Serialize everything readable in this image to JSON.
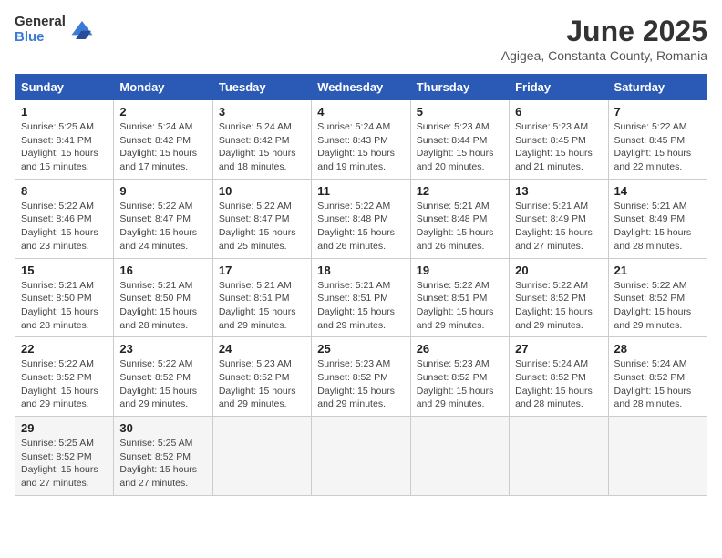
{
  "header": {
    "logo_general": "General",
    "logo_blue": "Blue",
    "month_title": "June 2025",
    "subtitle": "Agigea, Constanta County, Romania"
  },
  "weekdays": [
    "Sunday",
    "Monday",
    "Tuesday",
    "Wednesday",
    "Thursday",
    "Friday",
    "Saturday"
  ],
  "weeks": [
    [
      {
        "day": "1",
        "sunrise": "5:25 AM",
        "sunset": "8:41 PM",
        "daylight": "15 hours and 15 minutes."
      },
      {
        "day": "2",
        "sunrise": "5:24 AM",
        "sunset": "8:42 PM",
        "daylight": "15 hours and 17 minutes."
      },
      {
        "day": "3",
        "sunrise": "5:24 AM",
        "sunset": "8:42 PM",
        "daylight": "15 hours and 18 minutes."
      },
      {
        "day": "4",
        "sunrise": "5:24 AM",
        "sunset": "8:43 PM",
        "daylight": "15 hours and 19 minutes."
      },
      {
        "day": "5",
        "sunrise": "5:23 AM",
        "sunset": "8:44 PM",
        "daylight": "15 hours and 20 minutes."
      },
      {
        "day": "6",
        "sunrise": "5:23 AM",
        "sunset": "8:45 PM",
        "daylight": "15 hours and 21 minutes."
      },
      {
        "day": "7",
        "sunrise": "5:22 AM",
        "sunset": "8:45 PM",
        "daylight": "15 hours and 22 minutes."
      }
    ],
    [
      {
        "day": "8",
        "sunrise": "5:22 AM",
        "sunset": "8:46 PM",
        "daylight": "15 hours and 23 minutes."
      },
      {
        "day": "9",
        "sunrise": "5:22 AM",
        "sunset": "8:47 PM",
        "daylight": "15 hours and 24 minutes."
      },
      {
        "day": "10",
        "sunrise": "5:22 AM",
        "sunset": "8:47 PM",
        "daylight": "15 hours and 25 minutes."
      },
      {
        "day": "11",
        "sunrise": "5:22 AM",
        "sunset": "8:48 PM",
        "daylight": "15 hours and 26 minutes."
      },
      {
        "day": "12",
        "sunrise": "5:21 AM",
        "sunset": "8:48 PM",
        "daylight": "15 hours and 26 minutes."
      },
      {
        "day": "13",
        "sunrise": "5:21 AM",
        "sunset": "8:49 PM",
        "daylight": "15 hours and 27 minutes."
      },
      {
        "day": "14",
        "sunrise": "5:21 AM",
        "sunset": "8:49 PM",
        "daylight": "15 hours and 28 minutes."
      }
    ],
    [
      {
        "day": "15",
        "sunrise": "5:21 AM",
        "sunset": "8:50 PM",
        "daylight": "15 hours and 28 minutes."
      },
      {
        "day": "16",
        "sunrise": "5:21 AM",
        "sunset": "8:50 PM",
        "daylight": "15 hours and 28 minutes."
      },
      {
        "day": "17",
        "sunrise": "5:21 AM",
        "sunset": "8:51 PM",
        "daylight": "15 hours and 29 minutes."
      },
      {
        "day": "18",
        "sunrise": "5:21 AM",
        "sunset": "8:51 PM",
        "daylight": "15 hours and 29 minutes."
      },
      {
        "day": "19",
        "sunrise": "5:22 AM",
        "sunset": "8:51 PM",
        "daylight": "15 hours and 29 minutes."
      },
      {
        "day": "20",
        "sunrise": "5:22 AM",
        "sunset": "8:52 PM",
        "daylight": "15 hours and 29 minutes."
      },
      {
        "day": "21",
        "sunrise": "5:22 AM",
        "sunset": "8:52 PM",
        "daylight": "15 hours and 29 minutes."
      }
    ],
    [
      {
        "day": "22",
        "sunrise": "5:22 AM",
        "sunset": "8:52 PM",
        "daylight": "15 hours and 29 minutes."
      },
      {
        "day": "23",
        "sunrise": "5:22 AM",
        "sunset": "8:52 PM",
        "daylight": "15 hours and 29 minutes."
      },
      {
        "day": "24",
        "sunrise": "5:23 AM",
        "sunset": "8:52 PM",
        "daylight": "15 hours and 29 minutes."
      },
      {
        "day": "25",
        "sunrise": "5:23 AM",
        "sunset": "8:52 PM",
        "daylight": "15 hours and 29 minutes."
      },
      {
        "day": "26",
        "sunrise": "5:23 AM",
        "sunset": "8:52 PM",
        "daylight": "15 hours and 29 minutes."
      },
      {
        "day": "27",
        "sunrise": "5:24 AM",
        "sunset": "8:52 PM",
        "daylight": "15 hours and 28 minutes."
      },
      {
        "day": "28",
        "sunrise": "5:24 AM",
        "sunset": "8:52 PM",
        "daylight": "15 hours and 28 minutes."
      }
    ],
    [
      {
        "day": "29",
        "sunrise": "5:25 AM",
        "sunset": "8:52 PM",
        "daylight": "15 hours and 27 minutes."
      },
      {
        "day": "30",
        "sunrise": "5:25 AM",
        "sunset": "8:52 PM",
        "daylight": "15 hours and 27 minutes."
      },
      null,
      null,
      null,
      null,
      null
    ]
  ]
}
